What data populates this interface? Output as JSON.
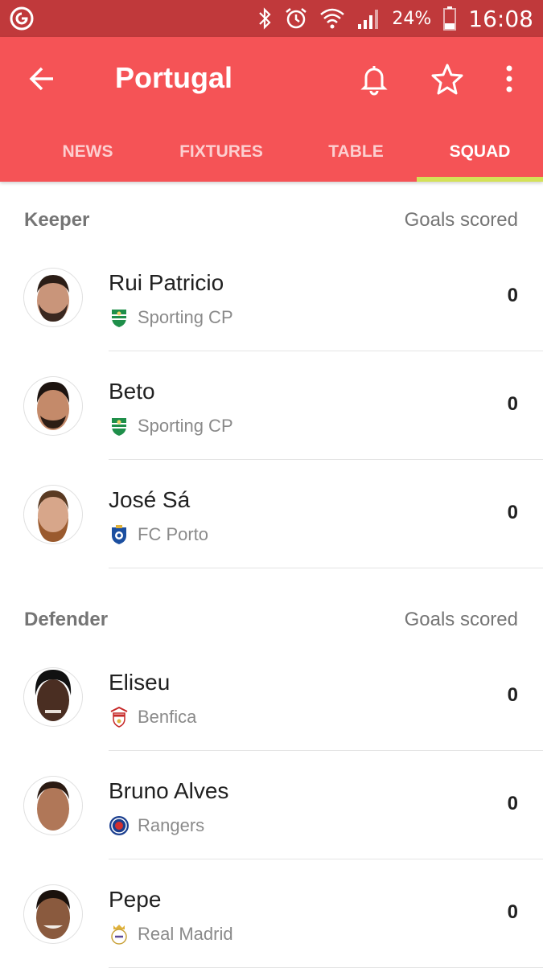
{
  "status_bar": {
    "battery": "24%",
    "time": "16:08",
    "icons": [
      "app-notification-icon",
      "bluetooth-icon",
      "alarm-icon",
      "wifi-icon",
      "signal-icon",
      "battery-icon"
    ]
  },
  "header": {
    "title": "Portugal",
    "icons": [
      "back-arrow-icon",
      "bell-icon",
      "star-icon",
      "more-vert-icon"
    ],
    "accent_color": "#f55356",
    "status_bar_color": "#c0393b",
    "indicator_color": "#d4e157"
  },
  "tabs": [
    {
      "label": "NEWS",
      "active": false
    },
    {
      "label": "FIXTURES",
      "active": false
    },
    {
      "label": "TABLE",
      "active": false
    },
    {
      "label": "SQUAD",
      "active": true
    }
  ],
  "squad": [
    {
      "position": "Keeper",
      "column_label": "Goals scored",
      "players": [
        {
          "name": "Rui Patricio",
          "club": "Sporting CP",
          "goals": "0"
        },
        {
          "name": "Beto",
          "club": "Sporting CP",
          "goals": "0"
        },
        {
          "name": "José Sá",
          "club": "FC Porto",
          "goals": "0"
        }
      ]
    },
    {
      "position": "Defender",
      "column_label": "Goals scored",
      "players": [
        {
          "name": "Eliseu",
          "club": "Benfica",
          "goals": "0"
        },
        {
          "name": "Bruno Alves",
          "club": "Rangers",
          "goals": "0"
        },
        {
          "name": "Pepe",
          "club": "Real Madrid",
          "goals": "0"
        }
      ]
    }
  ]
}
